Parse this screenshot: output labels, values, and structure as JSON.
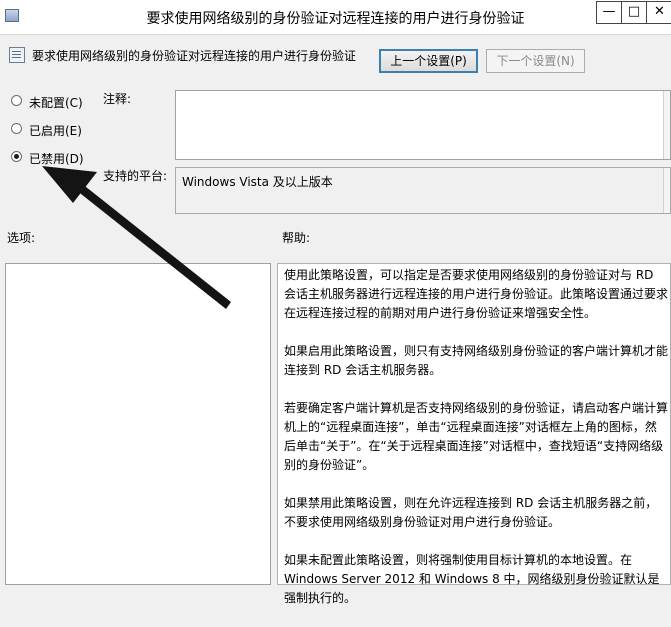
{
  "window": {
    "title": "要求使用网络级别的身份验证对远程连接的用户进行身份验证",
    "min_glyph": "—",
    "max_glyph": "□",
    "close_glyph": "✕"
  },
  "header": {
    "setting_name": "要求使用网络级别的身份验证对远程连接的用户进行身份验证",
    "prev_button": "上一个设置(P)",
    "next_button": "下一个设置(N)"
  },
  "state": {
    "options": [
      {
        "label": "未配置(C)",
        "selected": false
      },
      {
        "label": "已启用(E)",
        "selected": false
      },
      {
        "label": "已禁用(D)",
        "selected": true
      }
    ]
  },
  "comment": {
    "label": "注释:",
    "value": ""
  },
  "platform": {
    "label": "支持的平台:",
    "value": "Windows Vista 及以上版本"
  },
  "options_pane": {
    "label": "选项:"
  },
  "help_pane": {
    "label": "帮助:",
    "paragraphs": [
      "使用此策略设置，可以指定是否要求使用网络级别的身份验证对与 RD 会话主机服务器进行远程连接的用户进行身份验证。此策略设置通过要求在远程连接过程的前期对用户进行身份验证来增强安全性。",
      "如果启用此策略设置，则只有支持网络级别身份验证的客户端计算机才能连接到 RD 会话主机服务器。",
      "若要确定客户端计算机是否支持网络级别的身份验证，请启动客户端计算机上的“远程桌面连接”，单击“远程桌面连接”对话框左上角的图标，然后单击“关于”。在“关于远程桌面连接”对话框中，查找短语“支持网络级别的身份验证”。",
      "如果禁用此策略设置，则在允许远程连接到 RD 会话主机服务器之前，不要求使用网络级别身份验证对用户进行身份验证。",
      "如果未配置此策略设置，则将强制使用目标计算机的本地设置。在 Windows Server 2012 和 Windows 8 中，网络级别身份验证默认是强制执行的。"
    ]
  }
}
